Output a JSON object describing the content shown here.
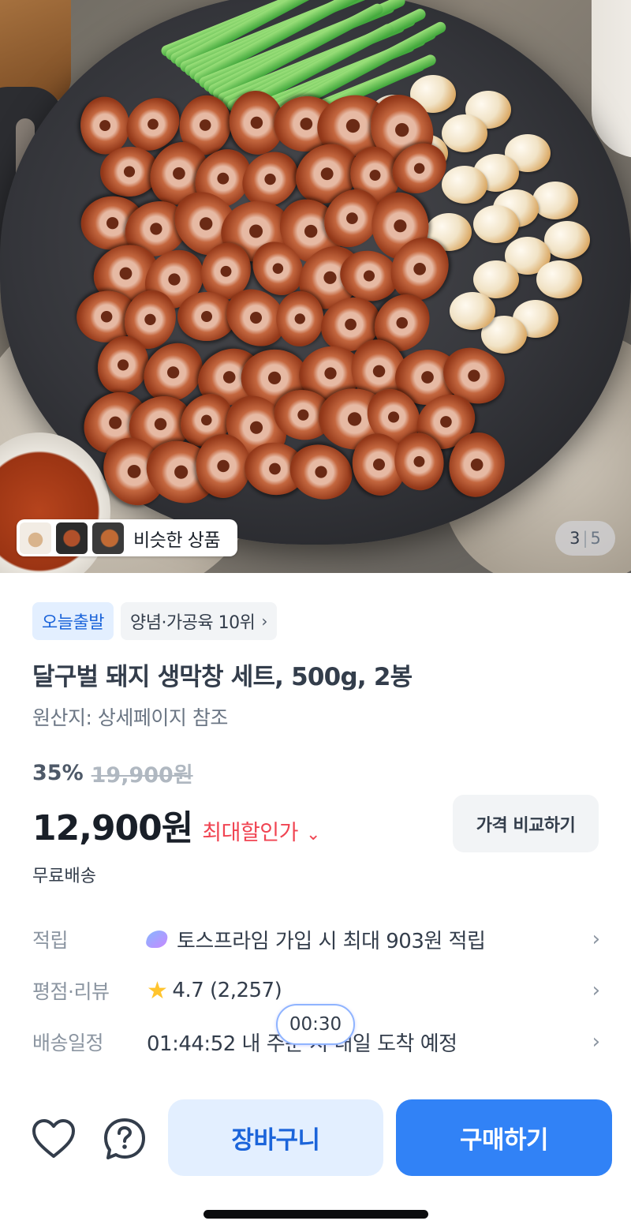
{
  "gallery": {
    "similar_label": "비슷한 상품",
    "current": "3",
    "separator": "|",
    "total": "5"
  },
  "badges": {
    "today_ship": "오늘출발",
    "ranking": "양념·가공육 10위"
  },
  "product": {
    "title": "달구벌 돼지 생막창 세트, 500g, 2봉",
    "origin": "원산지: 상세페이지 참조",
    "discount_rate": "35%",
    "original_price": "19,900원",
    "price": "12,900원",
    "max_discount_label": "최대할인가",
    "compare_label": "가격 비교하기",
    "shipping_fee": "무료배송"
  },
  "info": {
    "points_label": "적립",
    "points_value": "토스프라임 가입 시 최대 903원 적립",
    "rating_label": "평점·리뷰",
    "rating_value": "4.7 (2,257)",
    "delivery_label": "배송일정",
    "delivery_value": "01:44:52 내 주문 시 내일 도착 예정"
  },
  "timer": "00:30",
  "actions": {
    "cart": "장바구니",
    "buy": "구매하기"
  },
  "colors": {
    "accent": "#3182f6",
    "accent_light": "#e3efff",
    "sale_red": "#f04452"
  }
}
